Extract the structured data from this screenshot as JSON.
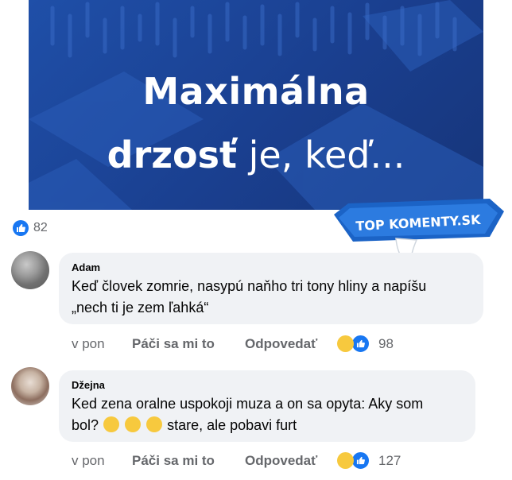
{
  "banner": {
    "line1": "Maximálna",
    "line2_bold": "drzosť",
    "line2_rest": " je, keď..."
  },
  "post": {
    "like_count": "82"
  },
  "logo": {
    "text": "TOP KOMENTY.SK"
  },
  "comments": [
    {
      "author": "Adam",
      "text_line1": "Keď človek zomrie, nasypú naňho tri tony hliny a napíšu",
      "text_line2": "„nech ti je zem ľahká“",
      "time": "v pon",
      "like_label": "Páči sa mi to",
      "reply_label": "Odpovedať",
      "reaction_count": "98"
    },
    {
      "author": "Džejna",
      "text_line1": "Ked zena oralne uspokoji muza a on sa opyta: Aky som",
      "text_line2_start": "bol?",
      "text_line2_end": " stare, ale pobavi furt",
      "time": "v pon",
      "like_label": "Páči sa mi to",
      "reply_label": "Odpovedať",
      "reaction_count": "127"
    }
  ],
  "colors": {
    "banner": "#1f4fa8",
    "facebook_blue": "#1877f2",
    "bubble_bg": "#f0f2f5",
    "secondary_text": "#65676b",
    "haha_yellow": "#f7c93e"
  },
  "icons": [
    "like-icon",
    "haha-icon",
    "rofl-emoji"
  ]
}
